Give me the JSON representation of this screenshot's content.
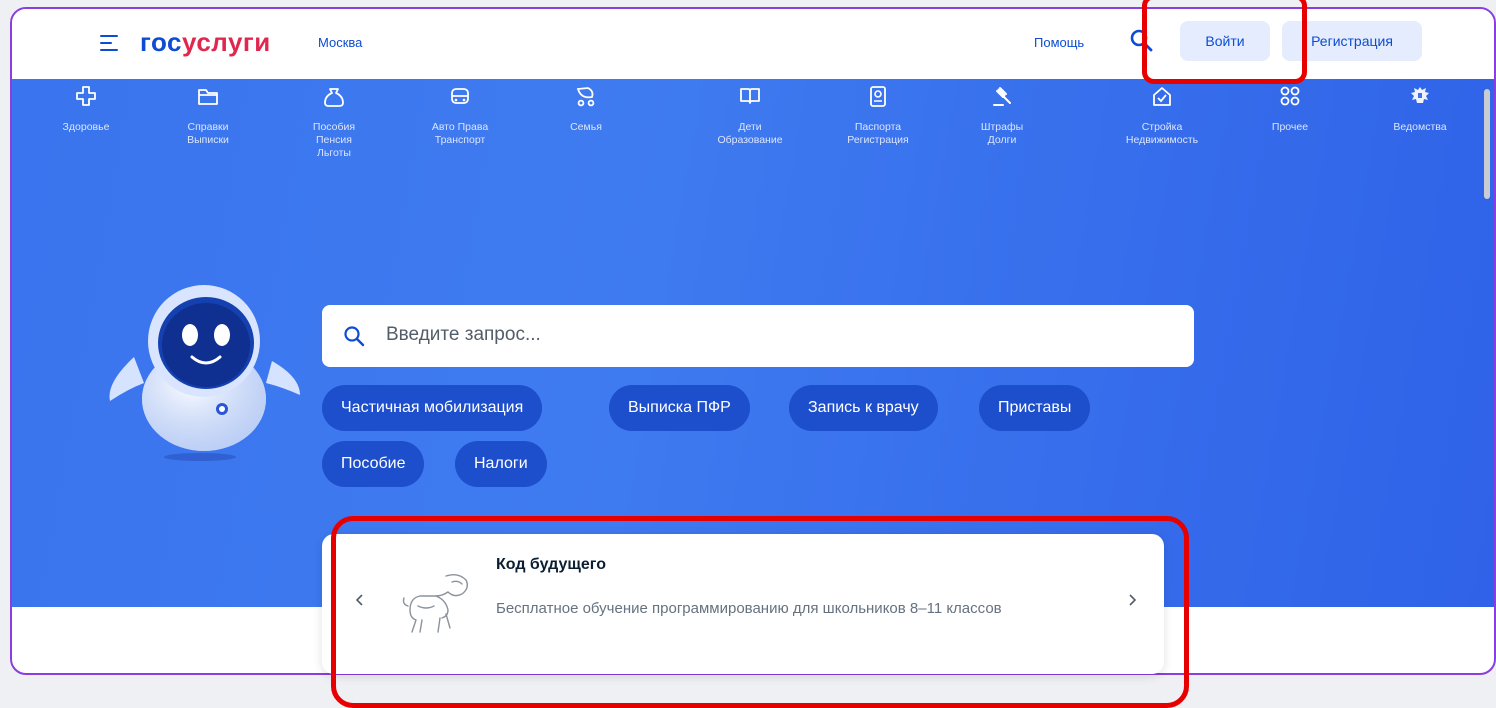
{
  "header": {
    "logo_part1": "гос",
    "logo_part2": "услуги",
    "city": "Москва",
    "help": "Помощь",
    "login": "Войти",
    "register": "Регистрация"
  },
  "categories": [
    {
      "label": "Здоровье",
      "icon": "health-cross-icon"
    },
    {
      "label": "Справки\nВыписки",
      "icon": "folder-icon"
    },
    {
      "label": "Пособия\nПенсия\nЛьготы",
      "icon": "bag-icon"
    },
    {
      "label": "Авто Права\nТранспорт",
      "icon": "car-icon"
    },
    {
      "label": "Семья",
      "icon": "stroller-icon"
    },
    {
      "label": "Дети\nОбразование",
      "icon": "book-icon"
    },
    {
      "label": "Паспорта\nРегистрация",
      "icon": "passport-icon"
    },
    {
      "label": "Штрафы\nДолги",
      "icon": "gavel-icon"
    },
    {
      "label": "Стройка\nНедвижимость",
      "icon": "house-icon"
    },
    {
      "label": "Прочее",
      "icon": "grid-icon"
    },
    {
      "label": "Ведомства",
      "icon": "emblem-icon"
    }
  ],
  "search": {
    "placeholder": "Введите запрос..."
  },
  "chips": [
    "Частичная мобилизация",
    "Выписка ПФР",
    "Запись к врачу",
    "Приставы",
    "Пособие",
    "Налоги"
  ],
  "promo": {
    "title": "Код будущего",
    "description": "Бесплатное обучение программированию для школьников 8–11 классов"
  },
  "colors": {
    "brand_blue": "#0d4cd3",
    "brand_red": "#e0284f",
    "hero_blue": "#3a74ee",
    "chip_blue": "#1d4ecb",
    "highlight_red": "#e60000",
    "frame_purple": "#8a3ee0"
  }
}
